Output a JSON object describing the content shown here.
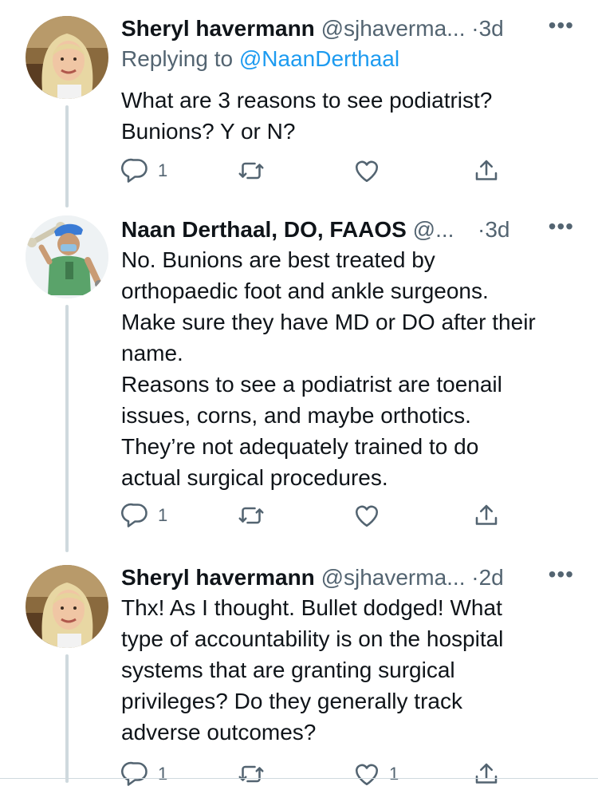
{
  "tweets": [
    {
      "author": "Sheryl havermann",
      "handle": "@sjhaverma...",
      "separator": "·",
      "time": "3d",
      "more": "•••",
      "replying_prefix": "Replying to",
      "replying_to": "@NaanDerthaal",
      "text": [
        "What are 3 reasons to see podiatrist?",
        "Bunions? Y or N?"
      ],
      "replies": "1",
      "retweets": "",
      "likes": ""
    },
    {
      "author": "Naan Derthaal, DO, FAAOS",
      "handle": "@...",
      "separator": "·",
      "time": "3d",
      "more": "•••",
      "text": [
        "No. Bunions are best treated by",
        "orthopaedic foot and ankle surgeons.",
        "Make sure they have MD or DO after their",
        "name.",
        "Reasons to see a podiatrist are toenail",
        "issues, corns, and maybe orthotics.",
        "They’re not adequately trained to do",
        "actual surgical procedures."
      ],
      "replies": "1",
      "retweets": "",
      "likes": ""
    },
    {
      "author": "Sheryl havermann",
      "handle": "@sjhaverma...",
      "separator": "·",
      "time": "2d",
      "more": "•••",
      "text": [
        "Thx! As I thought. Bullet dodged! What",
        "type of accountability is on the hospital",
        "systems that are granting surgical",
        "privileges? Do they generally track",
        "adverse outcomes?"
      ],
      "replies": "1",
      "retweets": "",
      "likes": "1"
    }
  ],
  "icons": {
    "reply": "speech-bubble-icon",
    "retweet": "retweet-arrows-icon",
    "like": "heart-icon",
    "share": "share-upload-icon"
  },
  "colors": {
    "text": "#0f1419",
    "secondary": "#536471",
    "link": "#1d9bf0",
    "thread_line": "#cfd9de"
  }
}
